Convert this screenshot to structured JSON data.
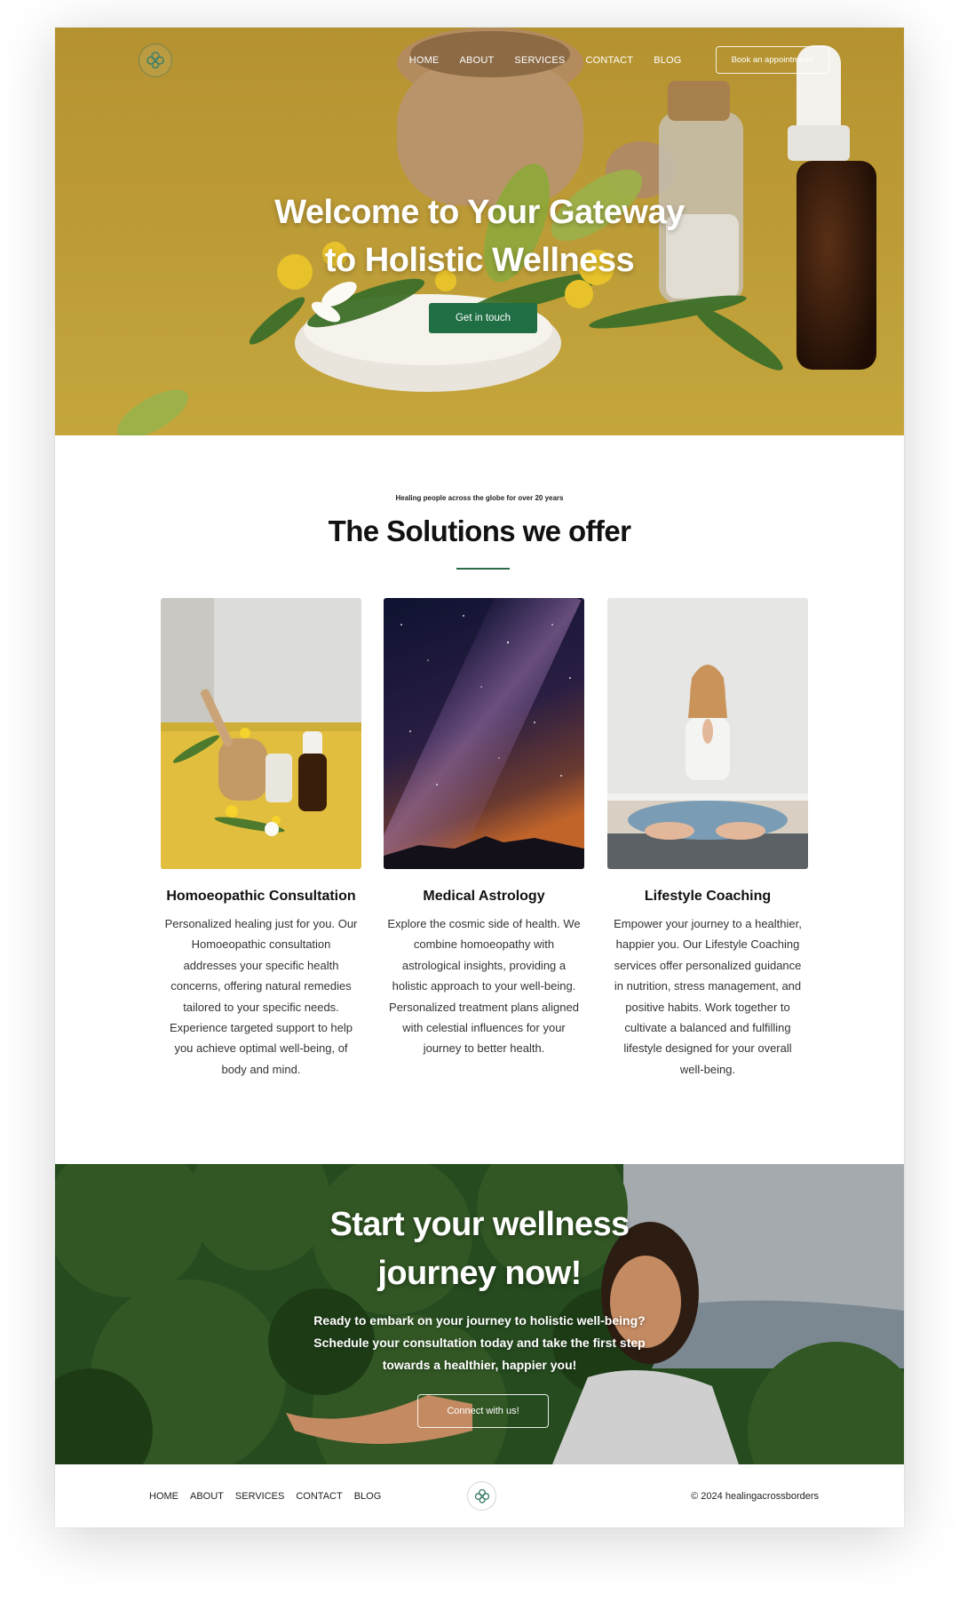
{
  "header": {
    "nav": [
      "HOME",
      "ABOUT",
      "SERVICES",
      "CONTACT",
      "BLOG"
    ],
    "book_button": "Book an appointment!"
  },
  "hero": {
    "title_line1": "Welcome to Your Gateway",
    "title_line2": "to Holistic Wellness",
    "button": "Get in touch"
  },
  "solutions": {
    "eyebrow": "Healing people across the globe for over 20 years",
    "title": "The Solutions we offer",
    "cards": [
      {
        "title": "Homoeopathic Consultation",
        "text": "Personalized healing just for you. Our Homoeopathic consultation addresses your specific health concerns, offering natural remedies tailored to your specific needs. Experience targeted support to help you achieve optimal well-being, of body and mind."
      },
      {
        "title": "Medical Astrology",
        "text": "Explore the cosmic side of health. We combine homoeopathy with astrological insights, providing a holistic approach to your well-being. Personalized treatment plans aligned with celestial influences for your journey to better health."
      },
      {
        "title": "Lifestyle Coaching",
        "text": "Empower your journey to a healthier, happier you. Our Lifestyle Coaching services offer personalized guidance in nutrition, stress management, and positive habits. Work together to cultivate a balanced and fulfilling lifestyle designed for your overall well-being."
      }
    ]
  },
  "cta": {
    "title_line1": "Start your wellness",
    "title_line2": "journey now!",
    "text_line1": "Ready to embark on your journey to holistic well-being?",
    "text_line2": "Schedule your consultation today and take the first step",
    "text_line3": "towards a healthier, happier you!",
    "button": "Connect with us!"
  },
  "footer": {
    "nav": [
      "HOME",
      "ABOUT",
      "SERVICES",
      "CONTACT",
      "BLOG"
    ],
    "copyright": "© 2024 healingacrossborders"
  },
  "colors": {
    "accent_green": "#1f6e44",
    "hero_yellow": "#cda83b"
  }
}
